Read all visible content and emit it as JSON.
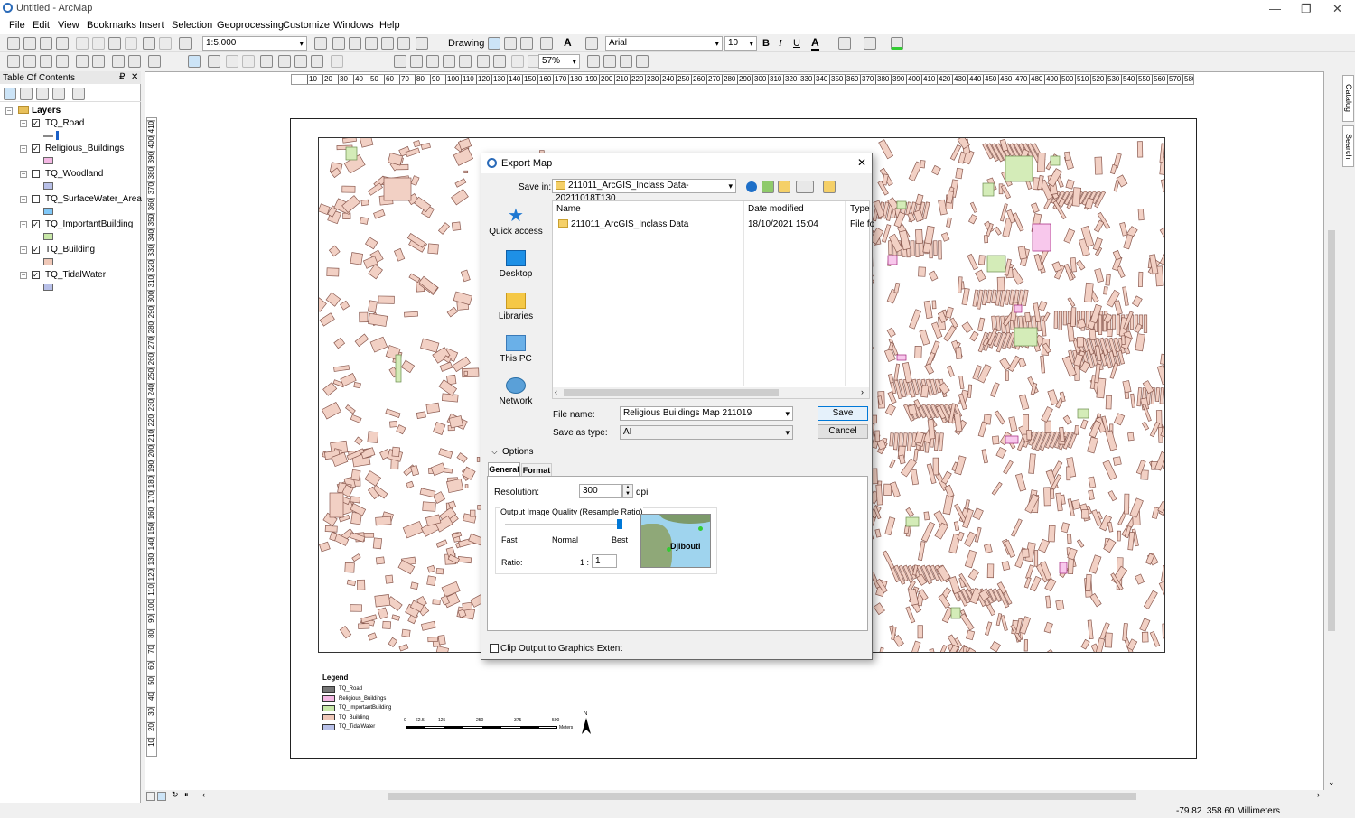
{
  "window": {
    "title": "Untitled - ArcMap"
  },
  "menubar": [
    "File",
    "Edit",
    "View",
    "Bookmarks",
    "Insert",
    "Selection",
    "Geoprocessing",
    "Customize",
    "Windows",
    "Help"
  ],
  "toolbar": {
    "scale": "1:5,000",
    "drawing_label": "Drawing",
    "font": "Arial",
    "font_size": "10",
    "bold": "B",
    "italic": "I",
    "underline": "U",
    "font_color": "A",
    "zoom": "57%"
  },
  "toc": {
    "title": "Table Of Contents",
    "pin": "₽",
    "close": "✕",
    "group": "Layers",
    "layers": [
      {
        "name": "TQ_Road",
        "checked": true,
        "color": "#1a60c8"
      },
      {
        "name": "Religious_Buildings",
        "checked": true,
        "color": "#f4b8e4"
      },
      {
        "name": "TQ_Woodland",
        "checked": false,
        "color": "#b8c0e8"
      },
      {
        "name": "TQ_SurfaceWater_Area",
        "checked": false,
        "color": "#80c8f8"
      },
      {
        "name": "TQ_ImportantBuilding",
        "checked": true,
        "color": "#c8e8a8"
      },
      {
        "name": "TQ_Building",
        "checked": true,
        "color": "#f0c8b8"
      },
      {
        "name": "TQ_TidalWater",
        "checked": true,
        "color": "#b8c0e8"
      }
    ]
  },
  "ruler": {
    "h_labels": [
      "10",
      "20",
      "30",
      "40",
      "50",
      "60",
      "70",
      "80",
      "90",
      "100",
      "110",
      "120",
      "130",
      "140",
      "150",
      "160",
      "170",
      "180",
      "190",
      "200",
      "210",
      "220",
      "230",
      "240",
      "250",
      "260",
      "270",
      "280",
      "290",
      "300",
      "310",
      "320",
      "330",
      "340",
      "350",
      "360",
      "370",
      "380",
      "390",
      "400",
      "410",
      "420",
      "430",
      "440",
      "450",
      "460",
      "470",
      "480",
      "490",
      "500",
      "510",
      "520",
      "530",
      "540",
      "550",
      "560",
      "570",
      "580"
    ],
    "v_labels": [
      "410",
      "400",
      "390",
      "380",
      "370",
      "360",
      "350",
      "340",
      "330",
      "320",
      "310",
      "300",
      "290",
      "280",
      "270",
      "260",
      "250",
      "240",
      "230",
      "220",
      "210",
      "200",
      "190",
      "180",
      "170",
      "160",
      "150",
      "140",
      "130",
      "120",
      "110",
      "100",
      "90",
      "80",
      "70",
      "60",
      "50",
      "40",
      "30",
      "20",
      "10"
    ]
  },
  "legend": {
    "title": "Legend",
    "items": [
      {
        "label": "TQ_Road",
        "color": "#777777"
      },
      {
        "label": "Religious_Buildings",
        "color": "#f4b8e4"
      },
      {
        "label": "TQ_ImportantBuilding",
        "color": "#c8e8a8"
      },
      {
        "label": "TQ_Building",
        "color": "#f0c8b8"
      },
      {
        "label": "TQ_TidalWater",
        "color": "#b8c0e8"
      }
    ],
    "scale_ticks": [
      "0",
      "62.5",
      "125",
      "250",
      "375",
      "500"
    ],
    "scale_unit": "Meters",
    "north": "N"
  },
  "dialog": {
    "title": "Export Map",
    "close": "✕",
    "save_in_label": "Save in:",
    "save_in_value": "211011_ArcGIS_Inclass Data-20211018T130",
    "nav": [
      "Quick access",
      "Desktop",
      "Libraries",
      "This PC",
      "Network"
    ],
    "columns": [
      "Name",
      "Date modified",
      "Type"
    ],
    "files": [
      {
        "name": "211011_ArcGIS_Inclass Data",
        "date": "18/10/2021 15:04",
        "type": "File fo"
      }
    ],
    "file_name_label": "File name:",
    "file_name_value": "Religious Buildings Map 211019",
    "save_type_label": "Save as type:",
    "save_type_value": "AI",
    "save_btn": "Save",
    "cancel_btn": "Cancel",
    "options_label": "Options",
    "tabs": [
      "General",
      "Format"
    ],
    "resolution_label": "Resolution:",
    "resolution_value": "300",
    "resolution_unit": "dpi",
    "quality_label": "Output Image Quality (Resample Ratio)",
    "quality_marks": [
      "Fast",
      "Normal",
      "Best"
    ],
    "quality_level": 1.0,
    "ratio_label": "Ratio:",
    "ratio_prefix": "1 :",
    "ratio_value": "1",
    "preview_text": "Djibouti",
    "clip_label": "Clip Output to Graphics Extent",
    "clip_checked": false
  },
  "right_tabs": [
    "Catalog",
    "Search"
  ],
  "status": {
    "coords": "-79.82  358.60 Millimeters"
  }
}
